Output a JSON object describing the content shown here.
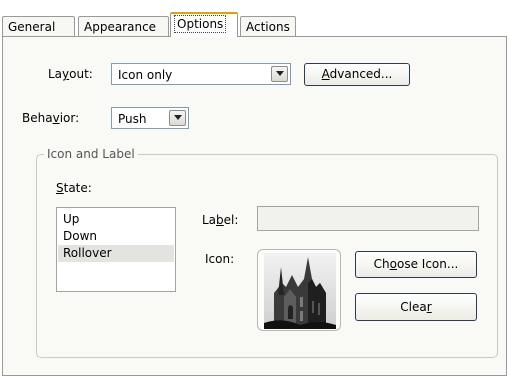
{
  "tabs": [
    {
      "label": "General"
    },
    {
      "label": "Appearance"
    },
    {
      "label": "Options",
      "active": true
    },
    {
      "label": "Actions"
    }
  ],
  "layout": {
    "label_pre": "La",
    "label_key": "y",
    "label_post": "out:",
    "value": "Icon only"
  },
  "advanced_button": {
    "key": "A",
    "rest": "dvanced..."
  },
  "behavior": {
    "label_pre": "Beha",
    "label_key": "v",
    "label_post": "ior:",
    "value": "Push"
  },
  "icon_and_label_group": {
    "title": "Icon and Label",
    "state_key": "S",
    "state_rest": "tate:",
    "states": [
      "Up",
      "Down",
      "Rollover"
    ],
    "selected_state": "Rollover",
    "label_pre": "La",
    "label_key": "b",
    "label_post": "el:",
    "label_value": "",
    "icon_label": "Icon:",
    "preview_icon": "cathedral-photo-icon"
  },
  "choose_icon_button": {
    "pre": "Ch",
    "key": "o",
    "post": "ose Icon..."
  },
  "clear_button": {
    "pre": "Clea",
    "key": "r"
  },
  "colors": {
    "active_tab_accent": "#e8a200",
    "panel_bg": "#f9f9f6",
    "selection_bg": "#e3e3df"
  }
}
